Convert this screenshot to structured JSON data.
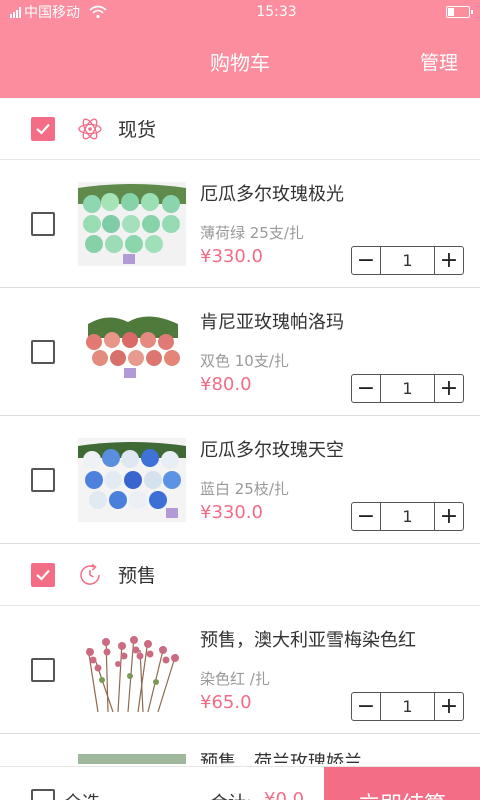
{
  "status_bar": {
    "carrier": "中国移动",
    "time": "15:33"
  },
  "header": {
    "title": "购物车",
    "manage": "管理"
  },
  "sections": [
    {
      "name": "现货",
      "items": [
        {
          "name": "厄瓜多尔玫瑰极光",
          "spec": "薄荷绿 25支/扎",
          "price": "¥330.0",
          "qty": "1"
        },
        {
          "name": "肯尼亚玫瑰帕洛玛",
          "spec": "双色 10支/扎",
          "price": "¥80.0",
          "qty": "1"
        },
        {
          "name": "厄瓜多尔玫瑰天空",
          "spec": "蓝白 25枝/扎",
          "price": "¥330.0",
          "qty": "1"
        }
      ]
    },
    {
      "name": "预售",
      "items": [
        {
          "name": "预售，澳大利亚雪梅染色红",
          "spec": "染色红 /扎",
          "price": "¥65.0",
          "qty": "1"
        },
        {
          "name": "预售，荷兰玫瑰娇兰",
          "spec": "",
          "price": "",
          "qty": ""
        }
      ]
    }
  ],
  "bottom": {
    "select_all": "全选",
    "total_label": "合计:",
    "total": "¥0.0",
    "checkout": "立即结算"
  },
  "colors": {
    "accent": "#f36d86",
    "header": "#fb8d9e"
  }
}
